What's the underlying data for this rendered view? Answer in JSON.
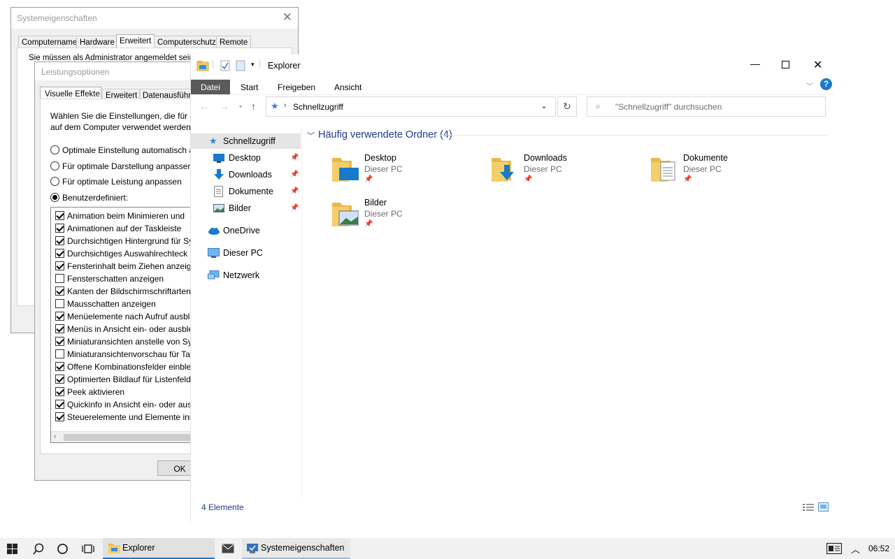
{
  "system_props": {
    "title": "Systemeigenschaften",
    "tabs": [
      "Computername",
      "Hardware",
      "Erweitert",
      "Computerschutz",
      "Remote"
    ],
    "active_tab": "Erweitert",
    "admin_note": "Sie müssen als Administrator angemeldet sein, um"
  },
  "perf_options": {
    "title": "Leistungsoptionen",
    "tabs": [
      "Visuelle Effekte",
      "Erweitert",
      "Datenausführung"
    ],
    "intro": [
      "Wählen Sie die Einstellungen, die für D",
      "auf dem Computer verwendet werden"
    ],
    "radios": [
      {
        "label": "Optimale Einstellung automatisch a",
        "selected": false
      },
      {
        "label": "Für optimale Darstellung anpassen",
        "selected": false
      },
      {
        "label": "Für optimale Leistung anpassen",
        "selected": false
      },
      {
        "label": "Benutzerdefiniert:",
        "selected": true
      }
    ],
    "effects": [
      {
        "label": "Animation beim Minimieren und",
        "checked": true
      },
      {
        "label": "Animationen auf der Taskleiste",
        "checked": true
      },
      {
        "label": "Durchsichtigen Hintergrund für Sy",
        "checked": true
      },
      {
        "label": "Durchsichtiges Auswahlrechteck a",
        "checked": true
      },
      {
        "label": "Fensterinhalt beim Ziehen anzeige",
        "checked": true
      },
      {
        "label": "Fensterschatten anzeigen",
        "checked": false
      },
      {
        "label": "Kanten der Bildschirmschriftarten",
        "checked": true
      },
      {
        "label": "Mausschatten anzeigen",
        "checked": false
      },
      {
        "label": "Menüelemente nach Aufruf ausbl",
        "checked": true
      },
      {
        "label": "Menüs in Ansicht ein- oder ausble",
        "checked": true
      },
      {
        "label": "Miniaturansichten anstelle von Sy",
        "checked": true
      },
      {
        "label": "Miniaturansichtenvorschau für Ta",
        "checked": false
      },
      {
        "label": "Offene Kombinationsfelder einble",
        "checked": true
      },
      {
        "label": "Optimierten Bildlauf für Listenfeld",
        "checked": true
      },
      {
        "label": "Peek aktivieren",
        "checked": true
      },
      {
        "label": "Quickinfo in Ansicht ein- oder aus",
        "checked": true
      },
      {
        "label": "Steuerelemente und Elemente inn",
        "checked": true
      }
    ],
    "ok_label": "OK"
  },
  "explorer": {
    "title": "Explorer",
    "ribbon_tabs": [
      "Datei",
      "Start",
      "Freigeben",
      "Ansicht"
    ],
    "address": "Schnellzugriff",
    "search_placeholder": "\"Schnellzugriff\" durchsuchen",
    "nav": {
      "quick_access": "Schnellzugriff",
      "pinned": [
        "Desktop",
        "Downloads",
        "Dokumente",
        "Bilder"
      ],
      "onedrive": "OneDrive",
      "this_pc": "Dieser PC",
      "network": "Netzwerk"
    },
    "group_header": "Häufig verwendete Ordner (4)",
    "folders": [
      {
        "name": "Desktop",
        "location": "Dieser PC",
        "icon": "desktop-folder-icon"
      },
      {
        "name": "Downloads",
        "location": "Dieser PC",
        "icon": "downloads-folder-icon"
      },
      {
        "name": "Dokumente",
        "location": "Dieser PC",
        "icon": "documents-folder-icon"
      },
      {
        "name": "Bilder",
        "location": "Dieser PC",
        "icon": "pictures-folder-icon"
      }
    ],
    "status": "4 Elemente",
    "help_glyph": "?"
  },
  "taskbar": {
    "apps": [
      "Explorer",
      "Systemeigenschaften"
    ],
    "time": "06:52"
  },
  "colors": {
    "accent_blue": "#1979ca",
    "file_tab": "#5a5a5a",
    "folder_yellow": "#f3cf6a",
    "nav_selected": "#e5e5e5"
  }
}
